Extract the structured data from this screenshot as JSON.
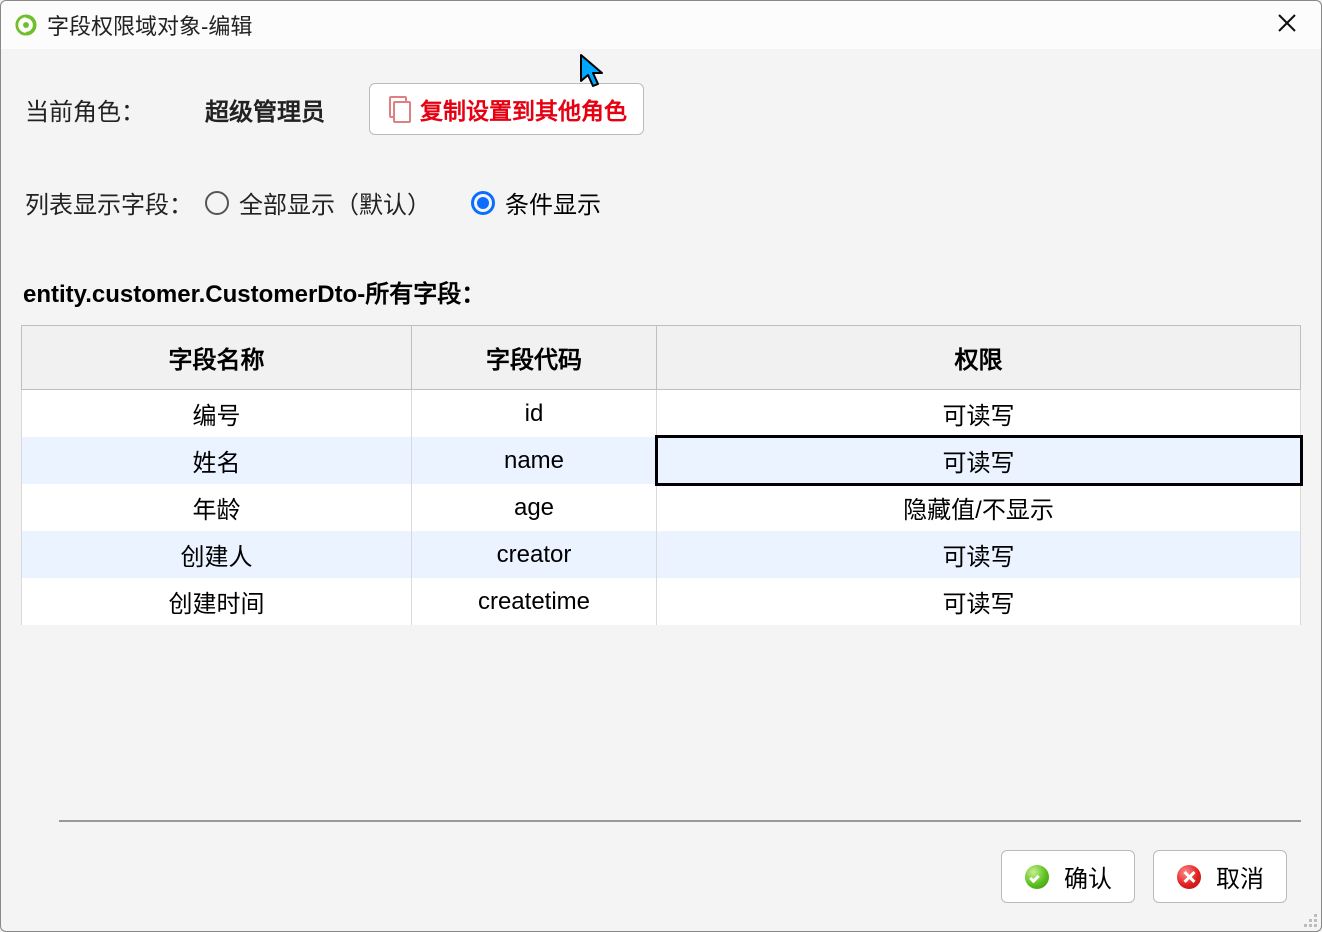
{
  "title": "字段权限域对象-编辑",
  "role": {
    "label": "当前角色：",
    "value": "超级管理员",
    "copy_button": "复制设置到其他角色"
  },
  "display": {
    "label": "列表显示字段：",
    "options": {
      "all": "全部显示（默认）",
      "conditional": "条件显示"
    },
    "selected": "conditional"
  },
  "entity_label": "entity.customer.CustomerDto-所有字段：",
  "table": {
    "headers": {
      "name": "字段名称",
      "code": "字段代码",
      "perm": "权限"
    },
    "rows": [
      {
        "name": "编号",
        "code": "id",
        "perm": "可读写"
      },
      {
        "name": "姓名",
        "code": "name",
        "perm": "可读写",
        "perm_selected": true
      },
      {
        "name": "年龄",
        "code": "age",
        "perm": "隐藏值/不显示"
      },
      {
        "name": "创建人",
        "code": "creator",
        "perm": "可读写"
      },
      {
        "name": "创建时间",
        "code": "createtime",
        "perm": "可读写"
      }
    ]
  },
  "footer": {
    "ok": "确认",
    "cancel": "取消"
  }
}
